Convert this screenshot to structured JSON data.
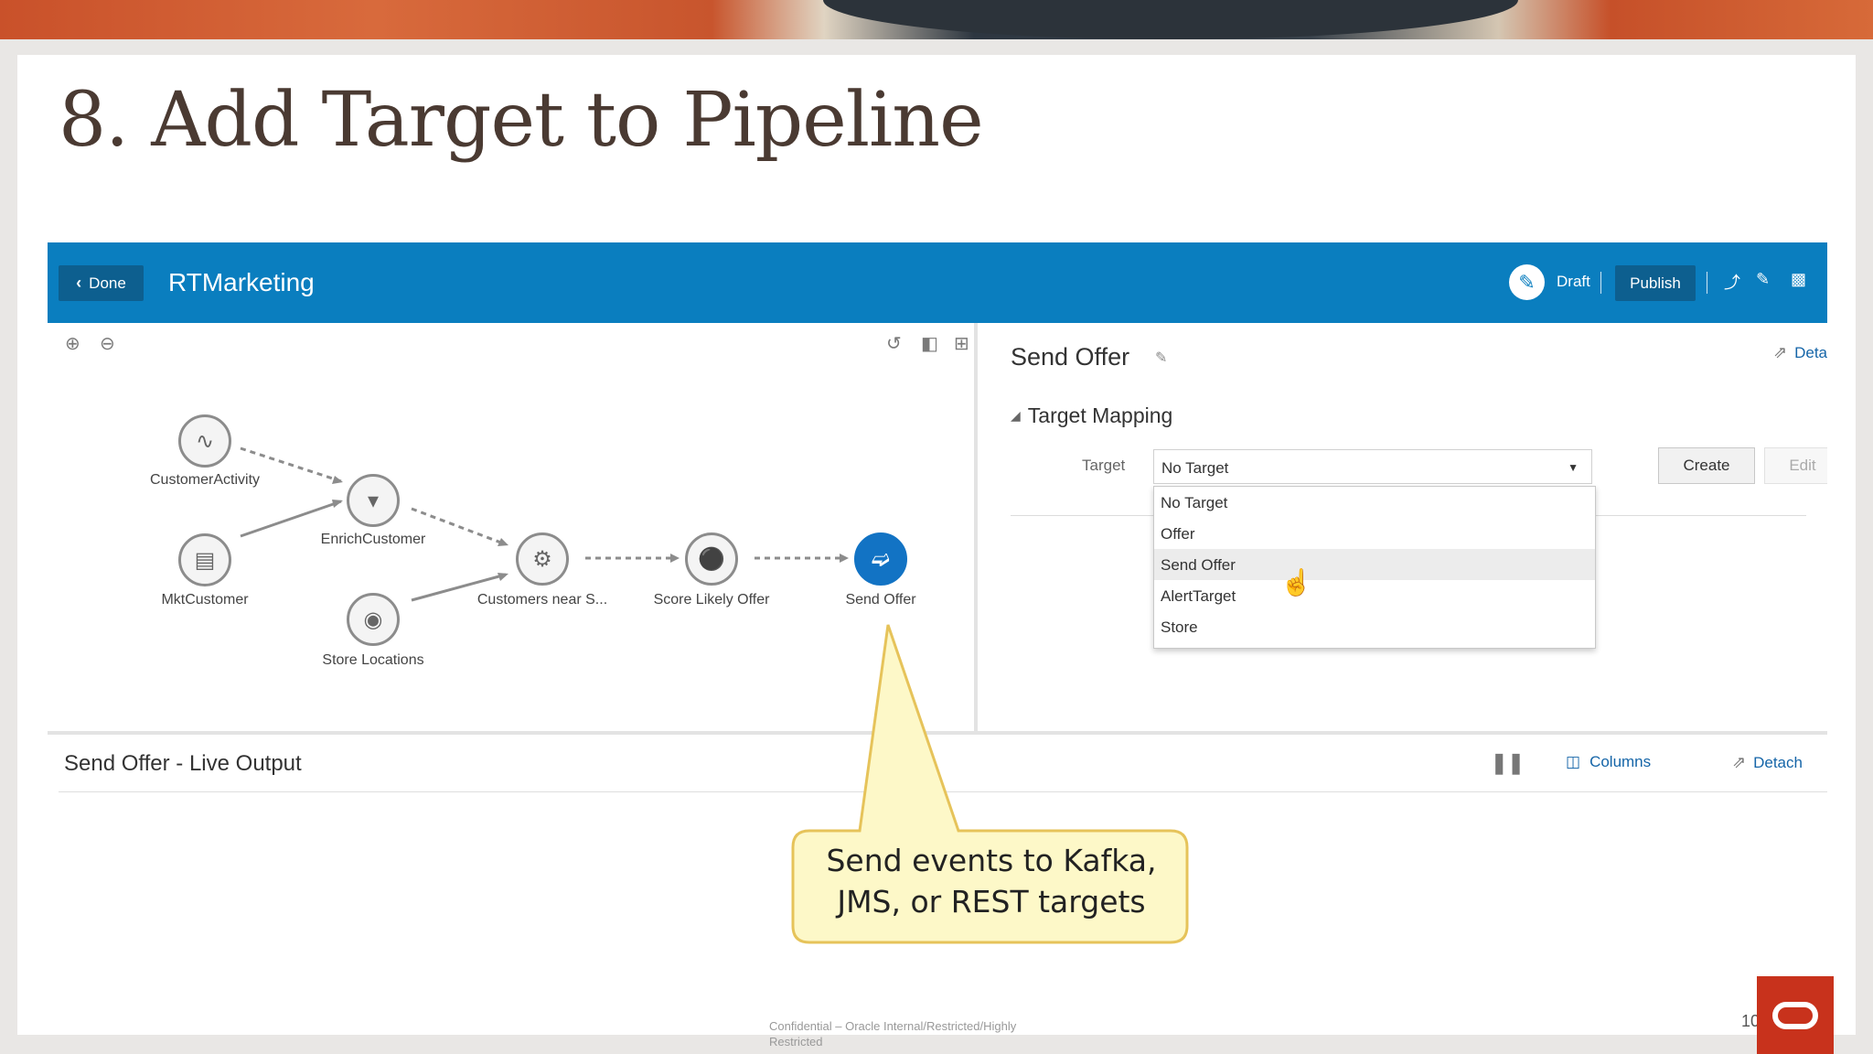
{
  "slide": {
    "title": "8. Add Target to Pipeline",
    "footer": "Confidential – Oracle Internal/Restricted/Highly Restricted",
    "page_number": "10"
  },
  "header": {
    "done_label": "Done",
    "app_name": "RTMarketing",
    "draft_label": "Draft",
    "publish_label": "Publish"
  },
  "pipeline": {
    "nodes": [
      {
        "label": "CustomerActivity",
        "icon": "activity-icon"
      },
      {
        "label": "MktCustomer",
        "icon": "document-icon"
      },
      {
        "label": "EnrichCustomer",
        "icon": "filter-icon"
      },
      {
        "label": "Store Locations",
        "icon": "globe-icon"
      },
      {
        "label": "Customers near S...",
        "icon": "gear-icon"
      },
      {
        "label": "Score Likely Offer",
        "icon": "lightbulb-icon"
      },
      {
        "label": "Send Offer",
        "icon": "target-icon"
      }
    ]
  },
  "properties": {
    "title": "Send Offer",
    "detach_label": "Detach",
    "section_title": "Target Mapping",
    "target_label": "Target",
    "target_value": "No Target",
    "create_label": "Create",
    "edit_label": "Edit",
    "options": [
      "No Target",
      "Offer",
      "Send Offer",
      "AlertTarget",
      "Store"
    ],
    "hovered_option": "Send Offer"
  },
  "live_output": {
    "title": "Send Offer - Live Output",
    "columns_label": "Columns",
    "detach_label": "Detach"
  },
  "callout": {
    "line1": "Send events to Kafka,",
    "line2": "JMS, or REST targets"
  },
  "colors": {
    "header_blue": "#0a7ebf",
    "active_node": "#1273c4",
    "callout_fill": "#fdf8c8",
    "callout_border": "#e6c35a",
    "oracle_red": "#c8321c"
  }
}
